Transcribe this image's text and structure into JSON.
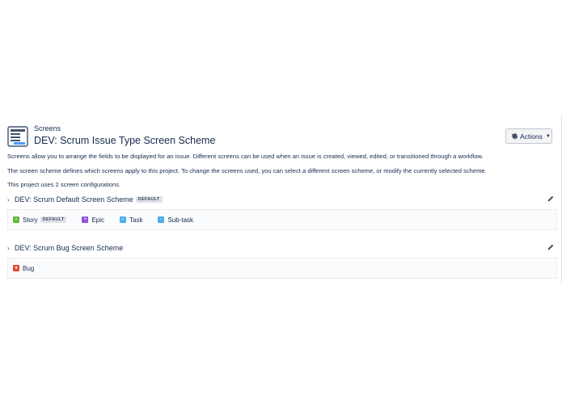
{
  "header": {
    "breadcrumb": "Screens",
    "title": "DEV: Scrum Issue Type Screen Scheme",
    "actions_label": "Actions",
    "actions_icon": "gear-icon"
  },
  "description": {
    "line1": "Screens allow you to arrange the fields to be displayed for an issue. Different screens can be used when an issue is created, viewed, edited, or transitioned through a workflow.",
    "line2": "The screen scheme defines which screens apply to this project. To change the screens used, you can select a different screen scheme, or modify the currently selected scheme.",
    "line3": "This project uses 2 screen configurations."
  },
  "schemes": [
    {
      "name": "DEV: Scrum Default Screen Scheme",
      "badge": "DEFAULT",
      "issue_types": [
        {
          "label": "Story",
          "badge": "DEFAULT",
          "icon": "story-icon",
          "color": "#63ba3c"
        },
        {
          "label": "Epic",
          "badge": "",
          "icon": "epic-icon",
          "color": "#904ee2"
        },
        {
          "label": "Task",
          "badge": "",
          "icon": "task-icon",
          "color": "#4bade8"
        },
        {
          "label": "Sub-task",
          "badge": "",
          "icon": "subtask-icon",
          "color": "#4bade8"
        }
      ]
    },
    {
      "name": "DEV: Scrum Bug Screen Scheme",
      "badge": "",
      "issue_types": [
        {
          "label": "Bug",
          "badge": "",
          "icon": "bug-icon",
          "color": "#e5493a"
        }
      ]
    }
  ]
}
